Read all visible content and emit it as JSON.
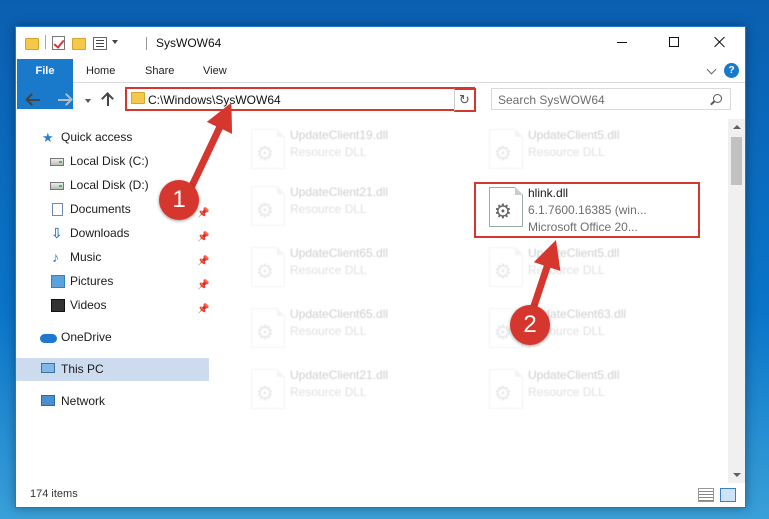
{
  "window": {
    "title": "SysWOW64"
  },
  "ribbon": {
    "tabs": [
      "File",
      "Home",
      "Share",
      "View"
    ],
    "help": "?"
  },
  "navbar": {
    "address": "C:\\Windows\\SysWOW64",
    "search_placeholder": "Search SysWOW64"
  },
  "sidebar": {
    "items": [
      {
        "label": "Quick access",
        "icon": "star-icon"
      },
      {
        "label": "Local Disk (C:)",
        "icon": "disk-icon"
      },
      {
        "label": "Local Disk (D:)",
        "icon": "disk-icon"
      },
      {
        "label": "Documents",
        "icon": "documents-icon"
      },
      {
        "label": "Downloads",
        "icon": "download-icon"
      },
      {
        "label": "Music",
        "icon": "music-icon"
      },
      {
        "label": "Pictures",
        "icon": "pictures-icon"
      },
      {
        "label": "Videos",
        "icon": "videos-icon"
      },
      {
        "label": "OneDrive",
        "icon": "cloud-icon"
      },
      {
        "label": "This PC",
        "icon": "computer-icon"
      },
      {
        "label": "Network",
        "icon": "network-icon"
      }
    ]
  },
  "files": [
    {
      "name": "UpdateClient19.dll",
      "type": "Resource DLL"
    },
    {
      "name": "UpdateClient5.dll",
      "type": "Resource DLL"
    },
    {
      "name": "UpdateClient21.dll",
      "type": "Resource DLL"
    },
    {
      "name": "hlink.dll",
      "version": "6.1.7600.16385 (win...",
      "product": "Microsoft Office 20..."
    },
    {
      "name": "UpdateClient65.dll",
      "type": "Resource DLL"
    },
    {
      "name": "UpdateClient5.dll",
      "type": "Resource DLL"
    },
    {
      "name": "UpdateClient65.dll",
      "type": "Resource DLL"
    },
    {
      "name": "UpdateClient63.dll",
      "type": "Resource DLL"
    },
    {
      "name": "UpdateClient21.dll",
      "type": "Resource DLL"
    },
    {
      "name": "UpdateClient5.dll",
      "type": "Resource DLL"
    }
  ],
  "status": {
    "item_count": "174 items"
  },
  "annotations": {
    "step1": "1",
    "step2": "2",
    "color": "#d5362d"
  }
}
